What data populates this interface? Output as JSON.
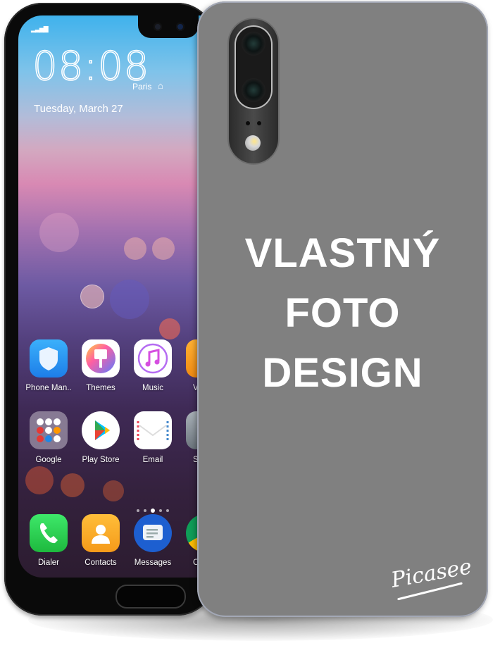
{
  "lockscreen": {
    "signal_icon": "signal-bars-icon",
    "time": "08:08",
    "city": "Paris",
    "home_icon": "home-icon",
    "date": "Tuesday, March 27"
  },
  "apps": [
    {
      "label": "Phone Man..",
      "icon": "shield-icon",
      "color": "#2a8ff0"
    },
    {
      "label": "Themes",
      "icon": "paintbrush-icon",
      "color": "#ffffff"
    },
    {
      "label": "Music",
      "icon": "music-note-icon",
      "color": "#ffffff"
    },
    {
      "label": "Vi",
      "icon": "video-icon",
      "color": "#f59a1a"
    },
    {
      "label": "Google",
      "icon": "google-folder-icon",
      "color": "#8a8090"
    },
    {
      "label": "Play Store",
      "icon": "play-store-icon",
      "color": "#ffffff"
    },
    {
      "label": "Email",
      "icon": "envelope-icon",
      "color": "#ffffff"
    },
    {
      "label": "Set",
      "icon": "settings-gear-icon",
      "color": "#8b949c"
    }
  ],
  "dock": [
    {
      "label": "Dialer",
      "icon": "phone-icon",
      "color": "#2bd04a"
    },
    {
      "label": "Contacts",
      "icon": "contact-person-icon",
      "color": "#f8a628"
    },
    {
      "label": "Messages",
      "icon": "message-bubble-icon",
      "color": "#1d5fd0"
    },
    {
      "label": "Ch",
      "icon": "chrome-icon",
      "color": "#db4437"
    }
  ],
  "page_indicator": {
    "count": 5,
    "active_index": 2
  },
  "case": {
    "color": "#808080",
    "headline_lines": [
      "VLASTNÝ",
      "FOTO",
      "DESIGN"
    ],
    "brand_logo": "Picasee"
  }
}
